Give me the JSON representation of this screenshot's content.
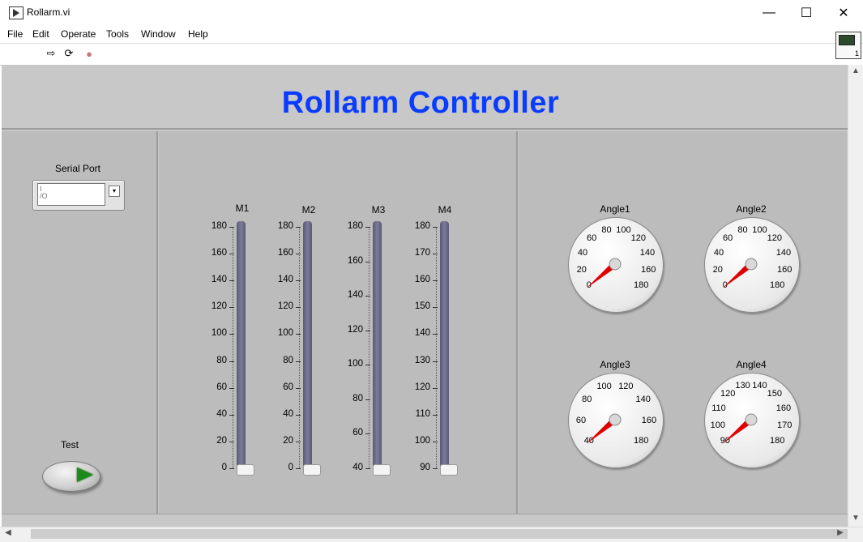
{
  "window": {
    "title": "Rollarm.vi",
    "minimize_icon": "minimize-icon",
    "maximize_icon": "maximize-icon",
    "close_icon": "close-icon",
    "min_glyph": "—",
    "max_glyph": "☐",
    "close_glyph": "✕"
  },
  "menu": {
    "items": [
      "File",
      "Edit",
      "Operate",
      "Tools",
      "Window",
      "Help"
    ]
  },
  "toolbar": {
    "run_glyph": "⇨",
    "run_cont_glyph": "⟳",
    "abort_glyph": "●",
    "vi_number": "1"
  },
  "panel": {
    "title": "Rollarm Controller",
    "title_color": "#0a3cff"
  },
  "serial_port": {
    "label": "Serial Port",
    "value": "",
    "io_prefix": "I/O"
  },
  "test": {
    "label": "Test"
  },
  "sliders": [
    {
      "label": "M1",
      "ticks": [
        "180",
        "160",
        "140",
        "120",
        "100",
        "80",
        "60",
        "40",
        "20",
        "0"
      ],
      "value": 0
    },
    {
      "label": "M2",
      "ticks": [
        "180",
        "160",
        "140",
        "120",
        "100",
        "80",
        "60",
        "40",
        "20",
        "0"
      ],
      "value": 0
    },
    {
      "label": "M3",
      "ticks": [
        "180",
        "160",
        "140",
        "120",
        "100",
        "80",
        "60",
        "40"
      ],
      "value": 40
    },
    {
      "label": "M4",
      "ticks": [
        "180",
        "170",
        "160",
        "150",
        "140",
        "130",
        "120",
        "110",
        "100",
        "90"
      ],
      "value": 90
    }
  ],
  "gauges": [
    {
      "label": "Angle1",
      "ticks": [
        "0",
        "20",
        "40",
        "60",
        "80",
        "100",
        "120",
        "140",
        "160",
        "180"
      ],
      "min": 0,
      "max": 180,
      "value": 0
    },
    {
      "label": "Angle2",
      "ticks": [
        "0",
        "20",
        "40",
        "60",
        "80",
        "100",
        "120",
        "140",
        "160",
        "180"
      ],
      "min": 0,
      "max": 180,
      "value": 0
    },
    {
      "label": "Angle3",
      "ticks": [
        "40",
        "60",
        "80",
        "100",
        "120",
        "140",
        "160",
        "180"
      ],
      "min": 40,
      "max": 180,
      "value": 40
    },
    {
      "label": "Angle4",
      "ticks": [
        "90",
        "100",
        "110",
        "120",
        "130",
        "140",
        "150",
        "160",
        "170",
        "180"
      ],
      "min": 90,
      "max": 180,
      "value": 90
    }
  ],
  "colors": {
    "needle": "#e00000",
    "slider_fill": "#6a6a88"
  }
}
